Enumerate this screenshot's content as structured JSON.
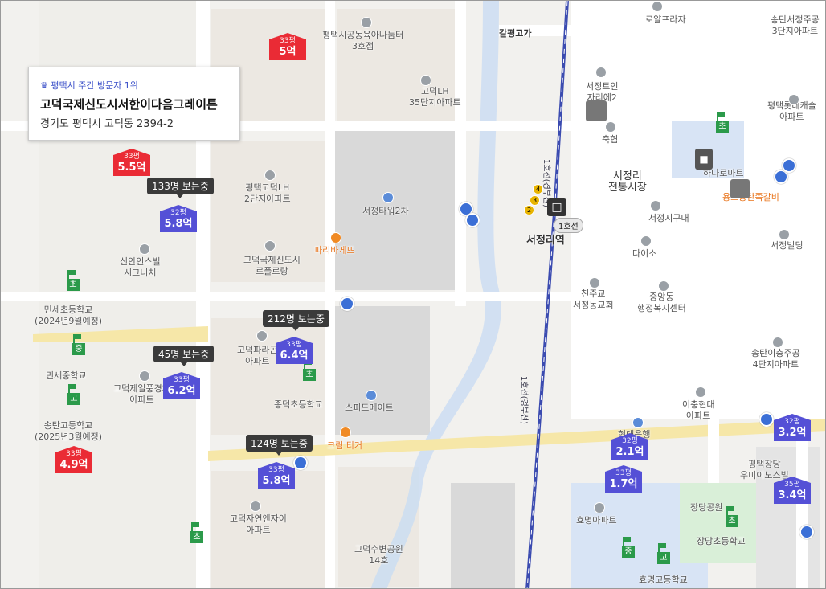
{
  "popup": {
    "rank": "♛ 평택시 주간 방문자 1위",
    "name": "고덕국제신도시서한이다음그레이튼",
    "address": "경기도 평택시 고덕동 2394-2"
  },
  "places": {
    "p1": "평택시공동육아나눔터\n3호점",
    "p2": "고덕LH\n35단지아파트",
    "p3": "평택고덕LH\n2단지아파트",
    "p4": "서정타워2차",
    "p5": "파리바게뜨",
    "p6": "신안인스빌\n시그니처",
    "p7": "고덕국제신도시\n르플로랑",
    "p8": "민세초등학교\n(2024년9월예정)",
    "p9": "민세중학교",
    "p10": "고덕제일풍경채\n아파트",
    "p11": "고덕파라곤\n아파트",
    "p12": "송탄고등학교\n(2025년3월예정)",
    "p13": "종덕초등학교",
    "p14": "스피드메이트",
    "p15": "크림 티거",
    "p16": "고덕자연앤자이\n아파트",
    "p17": "고덕수변공원\n14호",
    "p18": "서정트인\n자리에2",
    "p19": "축협",
    "p20": "서정리\n전통시장",
    "p21": "서정지구대",
    "p22": "다이소",
    "p23": "천주교\n서정동교회",
    "p24": "중앙동\n행정복지센터",
    "p25": "송탄이충주공\n4단지아파트",
    "p26": "이충현대\n아파트",
    "p27": "평택장당\n우미이노스빌",
    "p28": "장당공원",
    "p29": "장당초등학교",
    "p30": "효명아파트",
    "p31": "효명고등학교",
    "p32": "로얄프라자",
    "p33": "송탄서정주공\n3단지아파트",
    "p34": "평택롯데캐슬\n아파트",
    "p35": "하나로마트",
    "p36": "용스송탄쪽갈비",
    "p37": "서정빌딩",
    "p38": "갈평고가",
    "p39": "서정리역",
    "p40": "1호선(경부선)",
    "p41": "1호선(경부선)",
    "p42": "현대은행",
    "p43": "1호선"
  },
  "listings": [
    {
      "size": "33평",
      "price": "5억",
      "color": "red"
    },
    {
      "size": "33평",
      "price": "5.5억",
      "color": "red"
    },
    {
      "size": "32평",
      "price": "5.8억",
      "color": "blue"
    },
    {
      "size": "33평",
      "price": "6.4억",
      "color": "blue"
    },
    {
      "size": "33평",
      "price": "6.2억",
      "color": "blue"
    },
    {
      "size": "33평",
      "price": "4.9억",
      "color": "red"
    },
    {
      "size": "33평",
      "price": "5.8억",
      "color": "blue"
    },
    {
      "size": "32평",
      "price": "2.1억",
      "color": "blue"
    },
    {
      "size": "33평",
      "price": "1.7억",
      "color": "blue"
    },
    {
      "size": "32평",
      "price": "3.2억",
      "color": "blue"
    },
    {
      "size": "35평",
      "price": "3.4억",
      "color": "blue"
    }
  ],
  "viewers": [
    "133명 보는중",
    "212명 보는중",
    "45명 보는중",
    "124명 보는중"
  ],
  "schools": {
    "cho": "초",
    "jung": "중",
    "go": "고"
  },
  "station": {
    "exits": [
      "4",
      "3",
      "2"
    ],
    "icon": "train-icon"
  },
  "colors": {
    "red_marker": "#ea2b35",
    "blue_marker": "#5450d6",
    "school": "#2b9a4a",
    "rail": "#3b4bb0"
  }
}
